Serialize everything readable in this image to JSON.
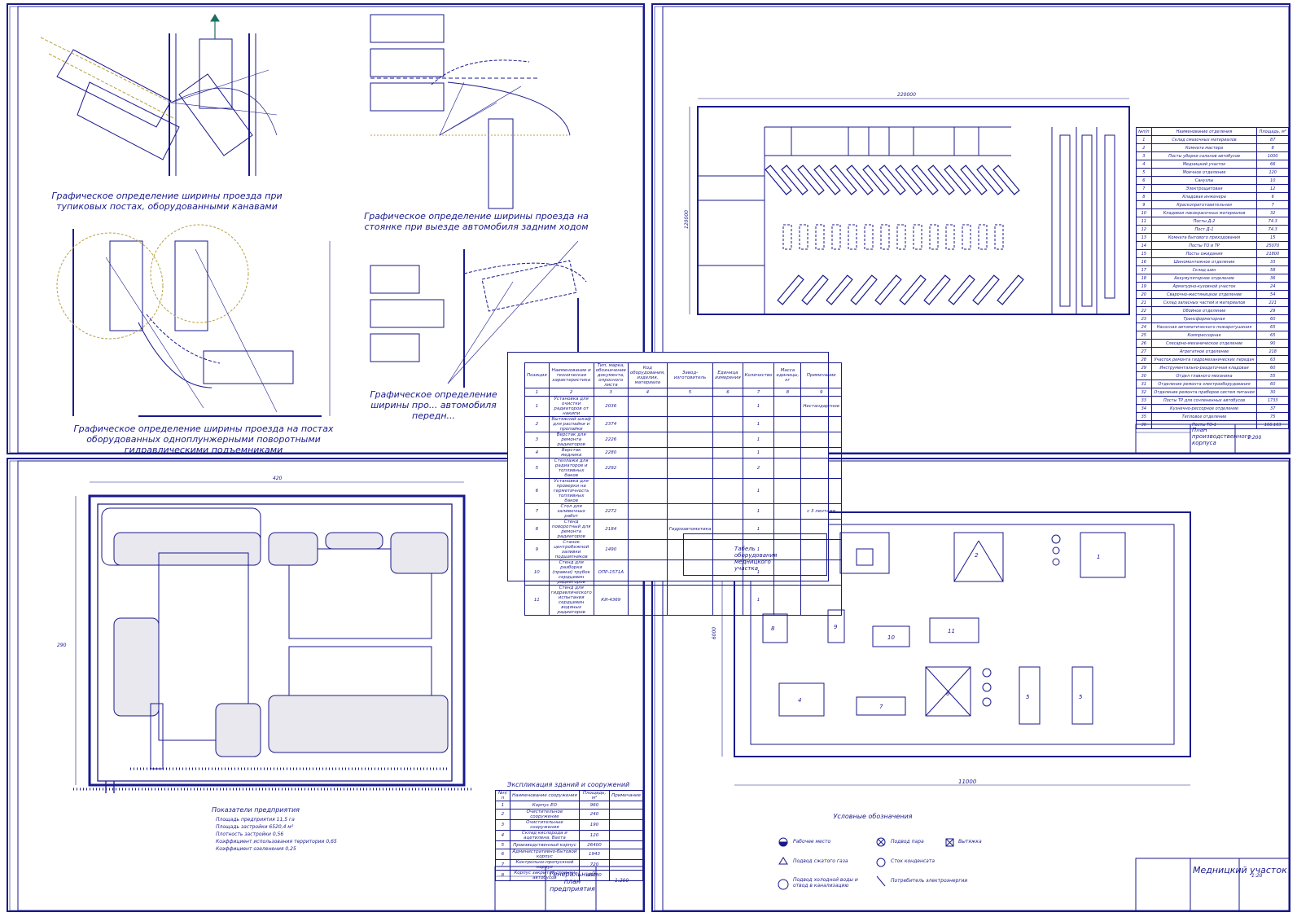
{
  "sheets": {
    "top_left": {
      "caption_1": "Графическое определение ширины проезда при тупиковых постах, оборудованными канавами",
      "caption_2": "Графическое определение ширины проезда на стоянке при выезде автомобиля задним ходом",
      "caption_3": "Графическое определение ширины проезда на постах оборудованных одноплунжерными поворотными гидравлическими подъемниками",
      "caption_4": "Графическое определение ширины про... автомобиля передн..."
    },
    "top_right": {
      "dim_width": "220000",
      "dim_height": "120000",
      "title_block": {
        "title": "План производственного корпуса",
        "scale": "1:200"
      },
      "rooms_header": [
        "№п/п",
        "Наименование отделения",
        "Площадь, м²"
      ],
      "rooms": [
        [
          "1",
          "Склад смазочных материалов",
          "87"
        ],
        [
          "2",
          "Комната мастера",
          "8"
        ],
        [
          "3",
          "Посты уборки салонов автобусов",
          "1000"
        ],
        [
          "4",
          "Медницкий участок",
          "66"
        ],
        [
          "5",
          "Моечное отделение",
          "120"
        ],
        [
          "6",
          "Санузлы",
          "10"
        ],
        [
          "7",
          "Электрощитовая",
          "12"
        ],
        [
          "8",
          "Кладовая инженера",
          "6"
        ],
        [
          "9",
          "Краскоприготовительная",
          "7"
        ],
        [
          "10",
          "Кладовая лакокрасочных материалов",
          "32"
        ],
        [
          "11",
          "Посты Д-2",
          "74.3"
        ],
        [
          "12",
          "Пост Д-1",
          "74.3"
        ],
        [
          "13",
          "Комната бытового приходования",
          "15"
        ],
        [
          "14",
          "Посты ТО и ТР",
          "25070"
        ],
        [
          "15",
          "Посты ожидания",
          "21800"
        ],
        [
          "16",
          "Шиномонтажное отделение",
          "33"
        ],
        [
          "17",
          "Склад шин",
          "58"
        ],
        [
          "18",
          "Аккумуляторное отделение",
          "36"
        ],
        [
          "19",
          "Арматурно-кузовной участок",
          "24"
        ],
        [
          "20",
          "Сварочно-жестяницкое отделение",
          "54"
        ],
        [
          "21",
          "Склад запасных частей и материалов",
          "221"
        ],
        [
          "22",
          "Обойное отделение",
          "29"
        ],
        [
          "23",
          "Трансформаторная",
          "60"
        ],
        [
          "24",
          "Насосная автоматического пожаротушения",
          "65"
        ],
        [
          "25",
          "Компрессорная",
          "65"
        ],
        [
          "26",
          "Слесарно-механическое отделение",
          "90"
        ],
        [
          "27",
          "Агрегатное отделение",
          "218"
        ],
        [
          "28",
          "Участок ремонта гидромеханических передач",
          "63"
        ],
        [
          "29",
          "Инструментально-раздаточная кладовая",
          "60"
        ],
        [
          "30",
          "Отдел главного механика",
          "55"
        ],
        [
          "31",
          "Отделение ремонта электрооборудования",
          "60"
        ],
        [
          "32",
          "Отделение ремонта приборов систем питания",
          "30"
        ],
        [
          "33",
          "Посты ТР для сочлененных автобусов",
          "1733"
        ],
        [
          "34",
          "Кузнечно-рессорное отделение",
          "37"
        ],
        [
          "35",
          "Тепловое отделение",
          "75"
        ],
        [
          "36",
          "Посты ТО-1",
          "166.103"
        ]
      ]
    },
    "bottom_left": {
      "dim_width": "420",
      "dim_height": "290",
      "indicators_title": "Показатели предприятия",
      "indicators": [
        "Площадь предприятия    11,5 га",
        "Площадь застройки        6520,4 м²",
        "Плотность застройки     0,56",
        "Коэффициент использования территории   0,65",
        "Коэффициент озеленения          0,25"
      ],
      "explication_title": "Экспликация зданий и сооружений",
      "explication_header": [
        "№п/п",
        "Наименование сооружения",
        "Площадь, м²",
        "Примечание"
      ],
      "explication": [
        [
          "1",
          "Корпус ЕО",
          "960",
          ""
        ],
        [
          "2",
          "Очистительное сооружение",
          "240",
          ""
        ],
        [
          "3",
          "Очистительные сооружения",
          "190",
          ""
        ],
        [
          "4",
          "Склад кислорода и ацетилена. Вахта",
          "120",
          ""
        ],
        [
          "5",
          "Производственный корпус",
          "26400",
          ""
        ],
        [
          "6",
          "Административно-бытовой корпус",
          "1943",
          ""
        ],
        [
          "7",
          "Контрольно-пропускной корпус",
          "720",
          ""
        ],
        [
          "8",
          "Корпус закрытой стоянки автобусов",
          "35280",
          ""
        ]
      ],
      "title_block": {
        "title": "Генеральный план предприятия",
        "scale": "1:200"
      }
    },
    "bottom_right": {
      "dim_width": "11000",
      "dim_height": "6000",
      "legend_title": "Условные обозначения",
      "legend": [
        "Рабочее место",
        "Подвод сжатого газа",
        "Подвод холодной воды и отвод в канализацию",
        "Подвод пара",
        "Сток конденсата",
        "Потребитель электроэнергии",
        "Вытяжка"
      ],
      "title_block": {
        "title": "Медницкий участок",
        "scale": "1:20"
      }
    },
    "overlay": {
      "header": [
        "Позиция",
        "Наименование и техническая характеристика",
        "Тип, марка, обозначение документа, опросного листа",
        "Код оборудования, изделия, материала",
        "Завод-изготовитель",
        "Единица измерения",
        "Количество",
        "Масса единицы, кг",
        "Примечание"
      ],
      "numbers": [
        "1",
        "2",
        "3",
        "4",
        "5",
        "6",
        "7",
        "8",
        "9"
      ],
      "rows": [
        [
          "1",
          "Установка для очистки радиаторов от накипи",
          "2036",
          "",
          "",
          "",
          "1",
          "",
          "Нестандартное"
        ],
        [
          "2",
          "Вытяжной шкаф для распайки и пропайки",
          "2374",
          "",
          "",
          "",
          "1",
          "",
          ""
        ],
        [
          "3",
          "Верстак для ремонта радиаторов",
          "2226",
          "",
          "",
          "",
          "1",
          "",
          ""
        ],
        [
          "4",
          "Верстак медника",
          "2280",
          "",
          "",
          "",
          "1",
          "",
          ""
        ],
        [
          "5",
          "Стеллажи для радиаторов и топливных баков",
          "2292",
          "",
          "",
          "",
          "2",
          "",
          ""
        ],
        [
          "6",
          "Установка для проверки на герметичность топливных баков",
          "",
          "",
          "",
          "",
          "1",
          "",
          ""
        ],
        [
          "7",
          "Стол для заливочных работ",
          "2272",
          "",
          "",
          "",
          "1",
          "",
          "с 3 лентами"
        ],
        [
          "8",
          "Стенд поворотный для ремонта радиаторов",
          "2184",
          "",
          "Гидроавтоматика",
          "",
          "1",
          "",
          ""
        ],
        [
          "9",
          "Станок центробежной заливки подшипников",
          "1490",
          "",
          "",
          "",
          "1",
          "",
          ""
        ],
        [
          "10",
          "Стенд для разборки (правки) трубок сердцевин радиаторов",
          "ОПР-1571А",
          "",
          "",
          "",
          "1",
          "",
          ""
        ],
        [
          "11",
          "Стенд для гидравлического испытания сердцевин водяных радиаторов",
          "КИ-4369",
          "",
          "",
          "",
          "1",
          "",
          ""
        ]
      ],
      "title_block": {
        "title": "Табель оборудования медницкого участка"
      }
    }
  }
}
